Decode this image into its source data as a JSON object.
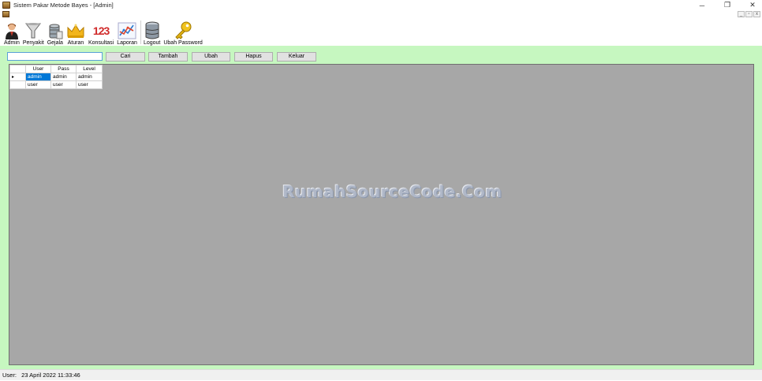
{
  "window": {
    "title": "Sistem Pakar Metode Bayes - [Admin]",
    "min": "─",
    "restore": "❐",
    "close": "✕"
  },
  "mdi": {
    "min": "_",
    "restore": "▫",
    "close": "x"
  },
  "toolbar": {
    "admin": "Admin",
    "penyakit": "Penyakit",
    "gejala": "Gejala",
    "aturan": "Aturan",
    "konsultasi": "Konsultasi",
    "konsultasi_icon_text": "123",
    "laporan": "Laporan",
    "logout": "Logout",
    "ubah_password": "Ubah Password"
  },
  "form": {
    "search_value": "",
    "cari": "Cari",
    "tambah": "Tambah",
    "ubah": "Ubah",
    "hapus": "Hapus",
    "keluar": "Keluar"
  },
  "grid": {
    "columns": [
      "User",
      "Pass",
      "Level"
    ],
    "rows": [
      [
        "admin",
        "admin",
        "admin"
      ],
      [
        "user",
        "user",
        "user"
      ]
    ],
    "current_row_marker": "▸"
  },
  "watermark": "RumahSourceCode.Com",
  "status": {
    "text": "User:   23 April 2022 11:33:46"
  },
  "colors": {
    "panel": "#c6f7c0",
    "grid_bg": "#a7a7a7",
    "selection": "#0078d7"
  }
}
